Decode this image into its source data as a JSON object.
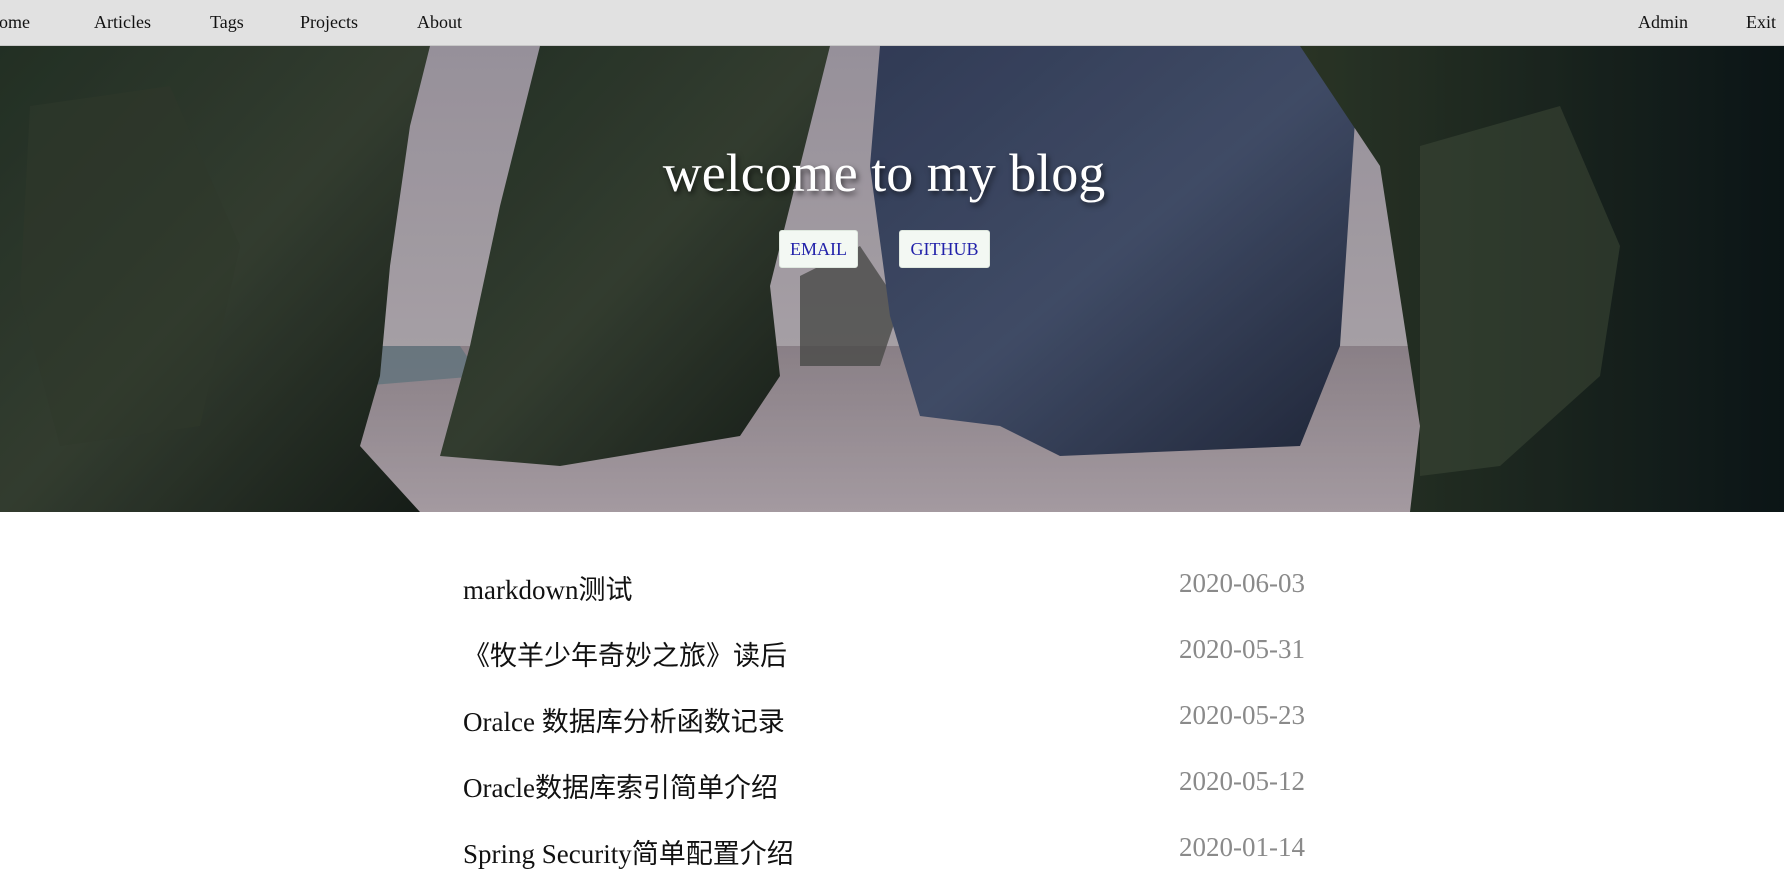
{
  "nav": {
    "left_items": [
      "Home",
      "Articles",
      "Tags",
      "Projects",
      "About"
    ],
    "right_items": [
      "Admin",
      "Exit"
    ]
  },
  "hero": {
    "title": "welcome to my blog",
    "buttons": [
      "EMAIL",
      "GITHUB"
    ]
  },
  "posts": [
    {
      "title": "markdown测试",
      "date": "2020-06-03"
    },
    {
      "title": "《牧羊少年奇妙之旅》读后",
      "date": "2020-05-31"
    },
    {
      "title": "Oralce 数据库分析函数记录",
      "date": "2020-05-23"
    },
    {
      "title": "Oracle数据库索引简单介绍",
      "date": "2020-05-12"
    },
    {
      "title": "Spring Security简单配置介绍",
      "date": "2020-01-14"
    }
  ],
  "colors": {
    "nav_bg": "#e1e1e1",
    "button_text": "#2222aa",
    "date_text": "#8a8a8a"
  }
}
